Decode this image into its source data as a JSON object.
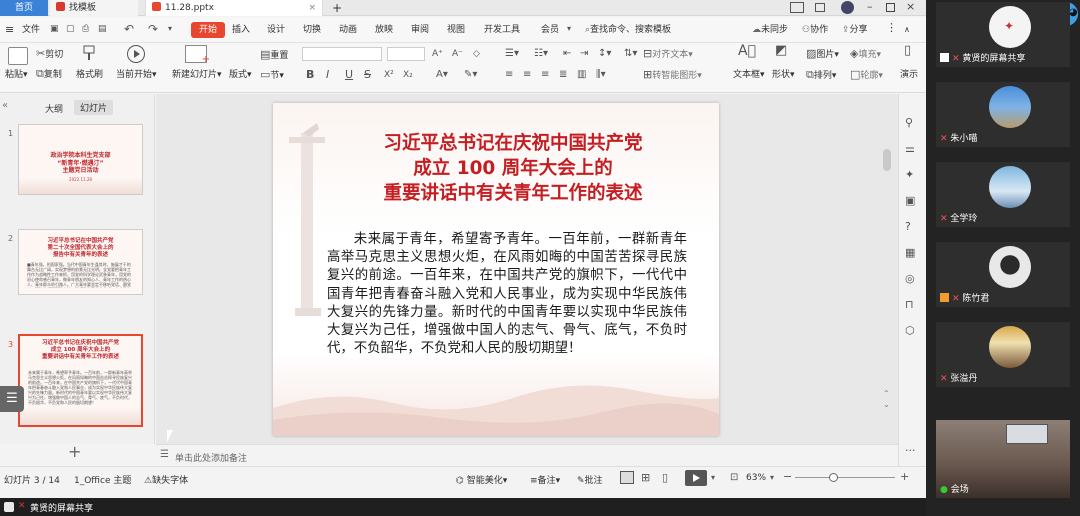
{
  "tabs": {
    "home": "首页",
    "stemplate": "找模板",
    "file": "11.28.pptx",
    "plus": "+"
  },
  "window": {
    "badge": "2"
  },
  "menu": {
    "file": "文件",
    "start": "开始",
    "insert": "插入",
    "design": "设计",
    "transition": "切换",
    "animation": "动画",
    "slideshow": "放映",
    "review": "审阅",
    "view": "视图",
    "devtools": "开发工具",
    "member": "会员",
    "search": "查找命令、搜索模板",
    "unsync": "未同步",
    "collab": "协作",
    "share": "分享"
  },
  "ribbon": {
    "paste": "粘贴",
    "cut": "剪切",
    "copy": "复制",
    "format_painter": "格式刷",
    "from_start": "当前开始",
    "new_slide": "新建幻灯片",
    "layout": "版式",
    "section": "节",
    "reset": "重置",
    "align_text": "对齐文本",
    "convert_smartart": "转智能图形",
    "textbox": "文本框",
    "shape": "形状",
    "arrange": "排列",
    "picture": "图片",
    "fill": "填充",
    "outline": "轮廓",
    "present": "演示",
    "bold": "B",
    "italic": "I",
    "underline": "U",
    "strike": "S"
  },
  "leftpane": {
    "tab_outline": "大纲",
    "tab_slides": "幻灯片",
    "slides": [
      {
        "num": "1",
        "title": "政治学院本科生党支部\n“新青年·燃遇汀”\n主题党日活动",
        "date": "2022.11.28"
      },
      {
        "num": "2",
        "title": "习近平总书记在中国共产党\n第二十次全国代表大会上的\n报告中有关青年的表述",
        "body": "■青年强，则国家强。当代中国青年生逢其时，施展才干的舞台无比广阔，实现梦想的前景无比光明。全党要把青年工作作为战略性工作来抓，用党的科学理论武装青年，用党的初心使命感召青年，做青年朋友的知心人、青年工作的热心人、青年群众的引路人。广大青年要坚定不移听党话、跟党走，怀抱梦想又脚踏实地，敢想敢为又善作善成，立志做有理想、敢担当、能吃苦、肯奋斗的新时代好青年，让青春在全面建设社会主义现代化国家的火热实践中绽放绚丽之花。"
      },
      {
        "num": "3",
        "title": "习近平总书记在庆祝中国共产党\n成立 100 周年大会上的\n重要讲话中有关青年工作的表述",
        "body": "未来属于青年，希望寄予青年。一百年前，一群新青年高举马克思主义思想火炬，在风雨如晦的中国苦苦探寻民族复兴的前途。一百年来，在中国共产党的旗帜下，一代代中国青年把青春奋斗融入党和人民事业，成为实现中华民族伟大复兴的先锋力量。新时代的中国青年要以实现中华民族伟大复兴为己任，增强做中国人的志气、骨气、底气，不负时代，不负韶华，不负党和人民的殷切期望！"
      }
    ],
    "add": "+"
  },
  "slide": {
    "title1": "习近平总书记在庆祝中国共产党",
    "title2": "成立 100 周年大会上的",
    "title3": "重要讲话中有关青年工作的表述",
    "body": "未来属于青年，希望寄予青年。一百年前，一群新青年高举马克思主义思想火炬，在风雨如晦的中国苦苦探寻民族复兴的前途。一百年来，在中国共产党的旗帜下，一代代中国青年把青春奋斗融入党和人民事业，成为实现中华民族伟大复兴的先锋力量。新时代的中国青年要以实现中华民族伟大复兴为己任，增强做中国人的志气、骨气、底气，不负时代，不负韶华，不负党和人民的殷切期望！"
  },
  "notes": {
    "placeholder": "单击此处添加备注"
  },
  "status": {
    "slide_count": "幻灯片 3 / 14",
    "theme": "1_Office 主题",
    "missing_font": "缺失字体",
    "smart_beautify": "智能美化",
    "notes": "备注",
    "comments": "批注",
    "zoom": "63%",
    "zoom_percent": 63
  },
  "bottombar": {
    "sharing": "黄贤的屏幕共享"
  },
  "conference": {
    "participants": [
      {
        "name": "黄贤的屏幕共享"
      },
      {
        "name": "朱小喵"
      },
      {
        "name": "全学玲"
      },
      {
        "name": "陈竹君"
      },
      {
        "name": "张溢丹"
      },
      {
        "name": "会场"
      }
    ]
  },
  "colors": {
    "accent": "#e8472f",
    "title_red": "#c41e23",
    "conf_bg": "#232323"
  }
}
